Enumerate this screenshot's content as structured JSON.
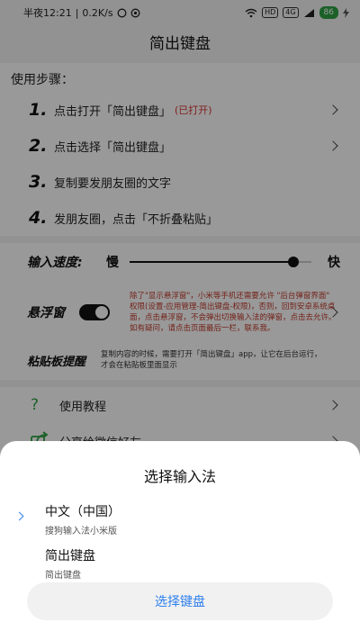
{
  "status_bar": {
    "time": "半夜12:21",
    "network_speed": "0.2K/s",
    "signal_badge": "4G",
    "hd_badge": "HD",
    "battery": "86"
  },
  "header": {
    "title": "简出键盘"
  },
  "steps": {
    "title": "使用步骤：",
    "items": [
      {
        "num": "1.",
        "text": "点击打开「简出键盘」",
        "status": "(已打开)"
      },
      {
        "num": "2.",
        "text": "点击选择「简出键盘」",
        "status": ""
      },
      {
        "num": "3.",
        "text": "复制要发朋友圈的文字",
        "status": ""
      },
      {
        "num": "4.",
        "text": "发朋友圈，点击「不折叠粘贴」",
        "status": ""
      }
    ]
  },
  "settings": {
    "speed_label": "输入速度:",
    "speed_slow": "慢",
    "speed_fast": "快",
    "speed_value": 0.9,
    "float_label": "悬浮窗",
    "float_enabled": true,
    "float_note": "除了\"显示悬浮窗\"，小米等手机还需要允许 \"后台弹窗界面\" 权限(设置-应用管理-简出键盘-权限)，否则，回到安卓系统桌面，点击悬浮窗，不会弹出切换输入法的弹窗，点击去允许。如有疑问，请点击页面最后一栏，联系我。",
    "clipboard_label": "粘贴板提醒",
    "clipboard_note": "复制内容的时候，需要打开「简出键盘」app，让它在后台运行，才会在粘贴板里面显示"
  },
  "links": {
    "tutorial": "使用教程",
    "share": "分享给微信好友"
  },
  "sheet": {
    "title": "选择输入法",
    "options": [
      {
        "name": "中文（中国）",
        "sub": "搜狗输入法小米版",
        "selected": true
      },
      {
        "name": "简出键盘",
        "sub": "简出键盘",
        "selected": false
      }
    ],
    "button_label": "选择键盘"
  },
  "colors": {
    "accent": "#2f80ed",
    "warning": "#c0392b",
    "icon_green": "#2ea043"
  }
}
